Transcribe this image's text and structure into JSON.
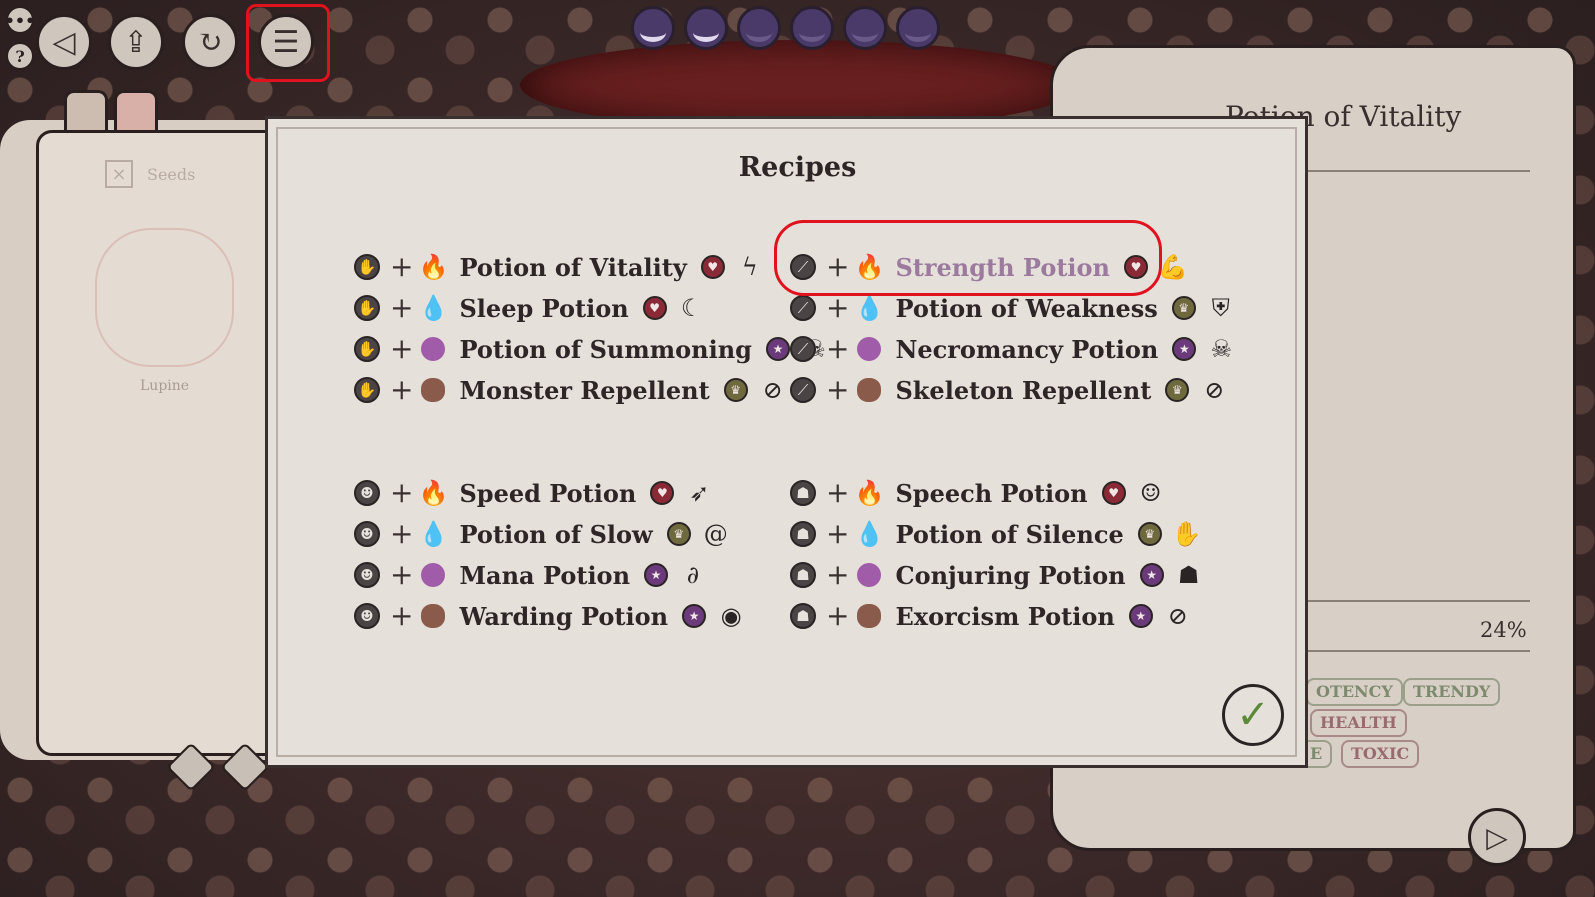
{
  "dialog": {
    "title": "Recipes",
    "confirm_icon": "checkmark-icon"
  },
  "groups": [
    {
      "ingredient_icon": "hand-sigil-icon",
      "ingredient_glyph": "✋",
      "recipes": [
        {
          "element": "fire",
          "name": "Potion of Vitality",
          "category": "health",
          "effect_icon": "lightning-icon",
          "effect_glyph": "ϟ"
        },
        {
          "element": "water",
          "name": "Sleep Potion",
          "category": "health",
          "effect_icon": "crescent-moon-icon",
          "effect_glyph": "☾"
        },
        {
          "element": "arcane",
          "name": "Potion of Summoning",
          "category": "mind",
          "effect_icon": "creature-icon",
          "effect_glyph": "☠"
        },
        {
          "element": "earth",
          "name": "Monster Repellent",
          "category": "earth",
          "effect_icon": "no-monster-icon",
          "effect_glyph": "⊘"
        }
      ]
    },
    {
      "ingredient_icon": "wand-sigil-icon",
      "ingredient_glyph": "⟋",
      "recipes": [
        {
          "element": "fire",
          "name": "Strength Potion",
          "category": "health",
          "effect_icon": "flexed-arm-icon",
          "effect_glyph": "💪",
          "selected": true
        },
        {
          "element": "water",
          "name": "Potion of Weakness",
          "category": "earth",
          "effect_icon": "broken-shield-icon",
          "effect_glyph": "⛨"
        },
        {
          "element": "arcane",
          "name": "Necromancy Potion",
          "category": "mind",
          "effect_icon": "skull-icon",
          "effect_glyph": "☠"
        },
        {
          "element": "earth",
          "name": "Skeleton Repellent",
          "category": "earth",
          "effect_icon": "no-skeleton-icon",
          "effect_glyph": "⊘"
        }
      ]
    },
    {
      "ingredient_icon": "mask-sigil-icon",
      "ingredient_glyph": "☻",
      "recipes": [
        {
          "element": "fire",
          "name": "Speed Potion",
          "category": "health",
          "effect_icon": "running-icon",
          "effect_glyph": "➶"
        },
        {
          "element": "water",
          "name": "Potion of Slow",
          "category": "earth",
          "effect_icon": "snail-icon",
          "effect_glyph": "@"
        },
        {
          "element": "arcane",
          "name": "Mana Potion",
          "category": "mind",
          "effect_icon": "spiral-wand-icon",
          "effect_glyph": "∂"
        },
        {
          "element": "earth",
          "name": "Warding Potion",
          "category": "mind",
          "effect_icon": "ward-eye-icon",
          "effect_glyph": "◉"
        }
      ]
    },
    {
      "ingredient_icon": "ghost-sigil-icon",
      "ingredient_glyph": "☗",
      "recipes": [
        {
          "element": "fire",
          "name": "Speech Potion",
          "category": "health",
          "effect_icon": "theater-mask-icon",
          "effect_glyph": "☺"
        },
        {
          "element": "water",
          "name": "Potion of Silence",
          "category": "earth",
          "effect_icon": "silence-figure-icon",
          "effect_glyph": "✋"
        },
        {
          "element": "arcane",
          "name": "Conjuring Potion",
          "category": "mind",
          "effect_icon": "ghost-icon",
          "effect_glyph": "☗"
        },
        {
          "element": "earth",
          "name": "Exorcism Potion",
          "category": "mind",
          "effect_icon": "no-ghost-icon",
          "effect_glyph": "⊘"
        }
      ]
    }
  ],
  "category_glyphs": {
    "health": "♥",
    "mind": "★",
    "earth": "♛"
  },
  "left_book": {
    "section_label": "Seeds",
    "item_label": "Lupine"
  },
  "right_scroll": {
    "title": "Potion of Vitality",
    "percentage": "24%",
    "tags": [
      "OTENCY",
      "TRENDY",
      "HEALTH",
      "E",
      "TOXIC"
    ]
  },
  "toolbar": {
    "menu_dots": "•••",
    "help": "?",
    "back_icon": "back-arrow-icon",
    "upload_icon": "upload-icon",
    "undo_icon": "undo-icon",
    "menu_icon": "hamburger-menu-icon",
    "next_icon": "next-arrow-icon"
  },
  "moons": [
    "lit",
    "lit",
    "dark",
    "dark",
    "dark",
    "dark"
  ],
  "colors": {
    "highlight": "#e0121e",
    "fire": "#d0563a",
    "water": "#7a84cc",
    "arcane": "#a05ca8",
    "earth": "#8a5a4a",
    "selected_text": "#9b7a9e",
    "confirm_check": "#5a8a3a"
  }
}
